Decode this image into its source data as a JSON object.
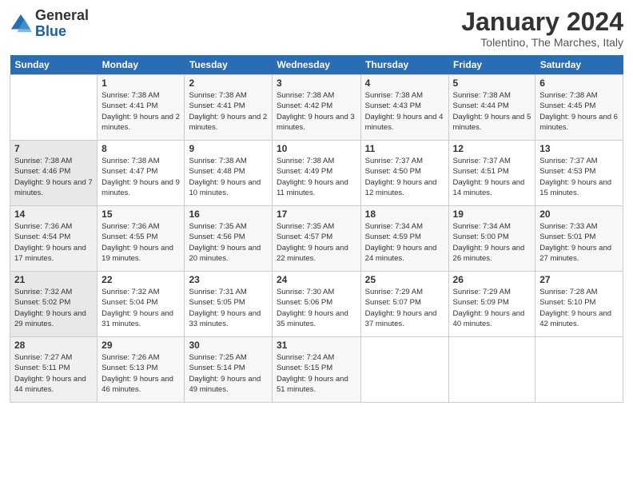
{
  "logo": {
    "general": "General",
    "blue": "Blue"
  },
  "title": {
    "month_year": "January 2024",
    "location": "Tolentino, The Marches, Italy"
  },
  "days_of_week": [
    "Sunday",
    "Monday",
    "Tuesday",
    "Wednesday",
    "Thursday",
    "Friday",
    "Saturday"
  ],
  "weeks": [
    [
      {
        "day": "",
        "sunrise": "",
        "sunset": "",
        "daylight": ""
      },
      {
        "day": "1",
        "sunrise": "Sunrise: 7:38 AM",
        "sunset": "Sunset: 4:41 PM",
        "daylight": "Daylight: 9 hours and 2 minutes."
      },
      {
        "day": "2",
        "sunrise": "Sunrise: 7:38 AM",
        "sunset": "Sunset: 4:41 PM",
        "daylight": "Daylight: 9 hours and 2 minutes."
      },
      {
        "day": "3",
        "sunrise": "Sunrise: 7:38 AM",
        "sunset": "Sunset: 4:42 PM",
        "daylight": "Daylight: 9 hours and 3 minutes."
      },
      {
        "day": "4",
        "sunrise": "Sunrise: 7:38 AM",
        "sunset": "Sunset: 4:43 PM",
        "daylight": "Daylight: 9 hours and 4 minutes."
      },
      {
        "day": "5",
        "sunrise": "Sunrise: 7:38 AM",
        "sunset": "Sunset: 4:44 PM",
        "daylight": "Daylight: 9 hours and 5 minutes."
      },
      {
        "day": "6",
        "sunrise": "Sunrise: 7:38 AM",
        "sunset": "Sunset: 4:45 PM",
        "daylight": "Daylight: 9 hours and 6 minutes."
      }
    ],
    [
      {
        "day": "7",
        "sunrise": "Sunrise: 7:38 AM",
        "sunset": "Sunset: 4:46 PM",
        "daylight": "Daylight: 9 hours and 7 minutes."
      },
      {
        "day": "8",
        "sunrise": "Sunrise: 7:38 AM",
        "sunset": "Sunset: 4:47 PM",
        "daylight": "Daylight: 9 hours and 9 minutes."
      },
      {
        "day": "9",
        "sunrise": "Sunrise: 7:38 AM",
        "sunset": "Sunset: 4:48 PM",
        "daylight": "Daylight: 9 hours and 10 minutes."
      },
      {
        "day": "10",
        "sunrise": "Sunrise: 7:38 AM",
        "sunset": "Sunset: 4:49 PM",
        "daylight": "Daylight: 9 hours and 11 minutes."
      },
      {
        "day": "11",
        "sunrise": "Sunrise: 7:37 AM",
        "sunset": "Sunset: 4:50 PM",
        "daylight": "Daylight: 9 hours and 12 minutes."
      },
      {
        "day": "12",
        "sunrise": "Sunrise: 7:37 AM",
        "sunset": "Sunset: 4:51 PM",
        "daylight": "Daylight: 9 hours and 14 minutes."
      },
      {
        "day": "13",
        "sunrise": "Sunrise: 7:37 AM",
        "sunset": "Sunset: 4:53 PM",
        "daylight": "Daylight: 9 hours and 15 minutes."
      }
    ],
    [
      {
        "day": "14",
        "sunrise": "Sunrise: 7:36 AM",
        "sunset": "Sunset: 4:54 PM",
        "daylight": "Daylight: 9 hours and 17 minutes."
      },
      {
        "day": "15",
        "sunrise": "Sunrise: 7:36 AM",
        "sunset": "Sunset: 4:55 PM",
        "daylight": "Daylight: 9 hours and 19 minutes."
      },
      {
        "day": "16",
        "sunrise": "Sunrise: 7:35 AM",
        "sunset": "Sunset: 4:56 PM",
        "daylight": "Daylight: 9 hours and 20 minutes."
      },
      {
        "day": "17",
        "sunrise": "Sunrise: 7:35 AM",
        "sunset": "Sunset: 4:57 PM",
        "daylight": "Daylight: 9 hours and 22 minutes."
      },
      {
        "day": "18",
        "sunrise": "Sunrise: 7:34 AM",
        "sunset": "Sunset: 4:59 PM",
        "daylight": "Daylight: 9 hours and 24 minutes."
      },
      {
        "day": "19",
        "sunrise": "Sunrise: 7:34 AM",
        "sunset": "Sunset: 5:00 PM",
        "daylight": "Daylight: 9 hours and 26 minutes."
      },
      {
        "day": "20",
        "sunrise": "Sunrise: 7:33 AM",
        "sunset": "Sunset: 5:01 PM",
        "daylight": "Daylight: 9 hours and 27 minutes."
      }
    ],
    [
      {
        "day": "21",
        "sunrise": "Sunrise: 7:32 AM",
        "sunset": "Sunset: 5:02 PM",
        "daylight": "Daylight: 9 hours and 29 minutes."
      },
      {
        "day": "22",
        "sunrise": "Sunrise: 7:32 AM",
        "sunset": "Sunset: 5:04 PM",
        "daylight": "Daylight: 9 hours and 31 minutes."
      },
      {
        "day": "23",
        "sunrise": "Sunrise: 7:31 AM",
        "sunset": "Sunset: 5:05 PM",
        "daylight": "Daylight: 9 hours and 33 minutes."
      },
      {
        "day": "24",
        "sunrise": "Sunrise: 7:30 AM",
        "sunset": "Sunset: 5:06 PM",
        "daylight": "Daylight: 9 hours and 35 minutes."
      },
      {
        "day": "25",
        "sunrise": "Sunrise: 7:29 AM",
        "sunset": "Sunset: 5:07 PM",
        "daylight": "Daylight: 9 hours and 37 minutes."
      },
      {
        "day": "26",
        "sunrise": "Sunrise: 7:29 AM",
        "sunset": "Sunset: 5:09 PM",
        "daylight": "Daylight: 9 hours and 40 minutes."
      },
      {
        "day": "27",
        "sunrise": "Sunrise: 7:28 AM",
        "sunset": "Sunset: 5:10 PM",
        "daylight": "Daylight: 9 hours and 42 minutes."
      }
    ],
    [
      {
        "day": "28",
        "sunrise": "Sunrise: 7:27 AM",
        "sunset": "Sunset: 5:11 PM",
        "daylight": "Daylight: 9 hours and 44 minutes."
      },
      {
        "day": "29",
        "sunrise": "Sunrise: 7:26 AM",
        "sunset": "Sunset: 5:13 PM",
        "daylight": "Daylight: 9 hours and 46 minutes."
      },
      {
        "day": "30",
        "sunrise": "Sunrise: 7:25 AM",
        "sunset": "Sunset: 5:14 PM",
        "daylight": "Daylight: 9 hours and 49 minutes."
      },
      {
        "day": "31",
        "sunrise": "Sunrise: 7:24 AM",
        "sunset": "Sunset: 5:15 PM",
        "daylight": "Daylight: 9 hours and 51 minutes."
      },
      {
        "day": "",
        "sunrise": "",
        "sunset": "",
        "daylight": ""
      },
      {
        "day": "",
        "sunrise": "",
        "sunset": "",
        "daylight": ""
      },
      {
        "day": "",
        "sunrise": "",
        "sunset": "",
        "daylight": ""
      }
    ]
  ]
}
